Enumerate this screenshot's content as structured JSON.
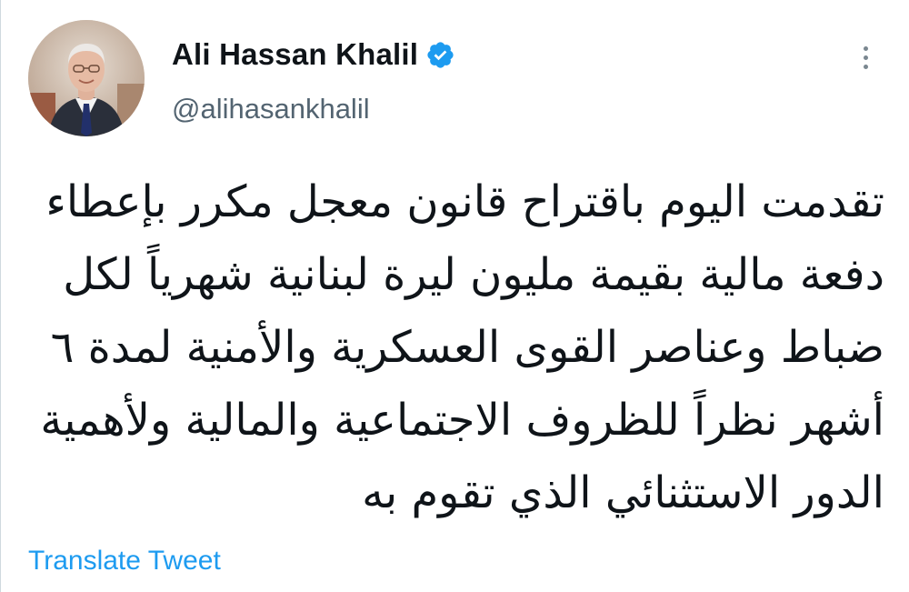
{
  "tweet": {
    "author": {
      "display_name": "Ali Hassan Khalil",
      "handle": "@alihasankhalil",
      "verified": true,
      "avatar_icon": "profile-photo"
    },
    "text": "تقدمت اليوم باقتراح قانون معجل مكرر بإعطاء\nدفعة مالية بقيمة مليون ليرة لبنانية شهرياً لكل\nضباط وعناصر القوى العسكرية والأمنية لمدة ٦\nأشهر نظراً للظروف الاجتماعية والمالية ولأهمية\nالدور الاستثنائي الذي تقوم به",
    "translate_label": "Translate Tweet",
    "more_icon": "more-vertical-icon"
  },
  "colors": {
    "accent": "#1d9bf0",
    "text": "#0f1419",
    "secondary": "#536471",
    "background": "#ffffff"
  }
}
